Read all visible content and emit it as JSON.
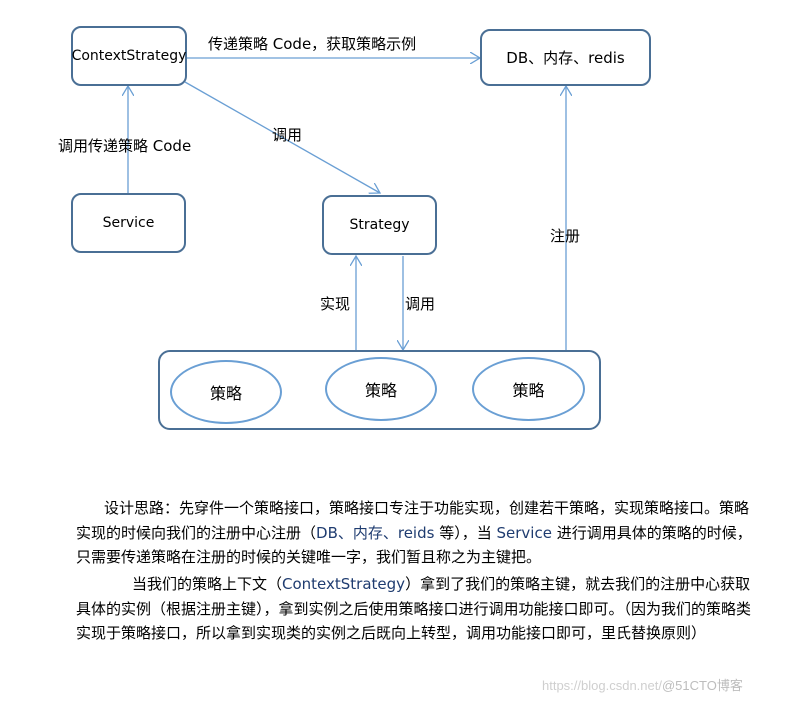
{
  "nodes": {
    "context_strategy": "ContextStrategy",
    "registry": "DB、内存、redis",
    "service": "Service",
    "strategy": "Strategy",
    "impls": [
      "策略",
      "策略",
      "策略"
    ]
  },
  "edges": {
    "context_registry": "传递策略 Code，获取策略示例",
    "service_context": "调用传递策略 Code",
    "context_strategy": "调用",
    "impl_strategy": "实现",
    "strategy_impl": "调用",
    "impl_registry": "注册"
  },
  "description": {
    "p1_a": "设计思路：先穿件一个策略接口，策略接口专注于功能实现，创建若干策略，实现策略接口。策略实现的时候向我们的注册中心注册（",
    "p1_db": "DB、内存、reids",
    "p1_b": " 等），当 ",
    "p1_service": "Service",
    "p1_c": " 进行调用具体的策略的时候，只需要传递策略在注册的时候的关键唯一字，我们暂且称之为主键把。",
    "p2_a": "当我们的策略上下文（",
    "p2_ctx": "ContextStrategy",
    "p2_b": "）拿到了我们的策略主键，就去我们的注册中心获取具体的实例（根据注册主键），拿到实例之后使用策略接口进行调用功能接口即可。（因为我们的策略类实现于策略接口，所以拿到实现类的实例之后既向上转型，调用功能接口即可，里氏替换原则）"
  },
  "watermark": {
    "url": "https://blog.csdn.net/",
    "brand": "@51CTO博客"
  }
}
